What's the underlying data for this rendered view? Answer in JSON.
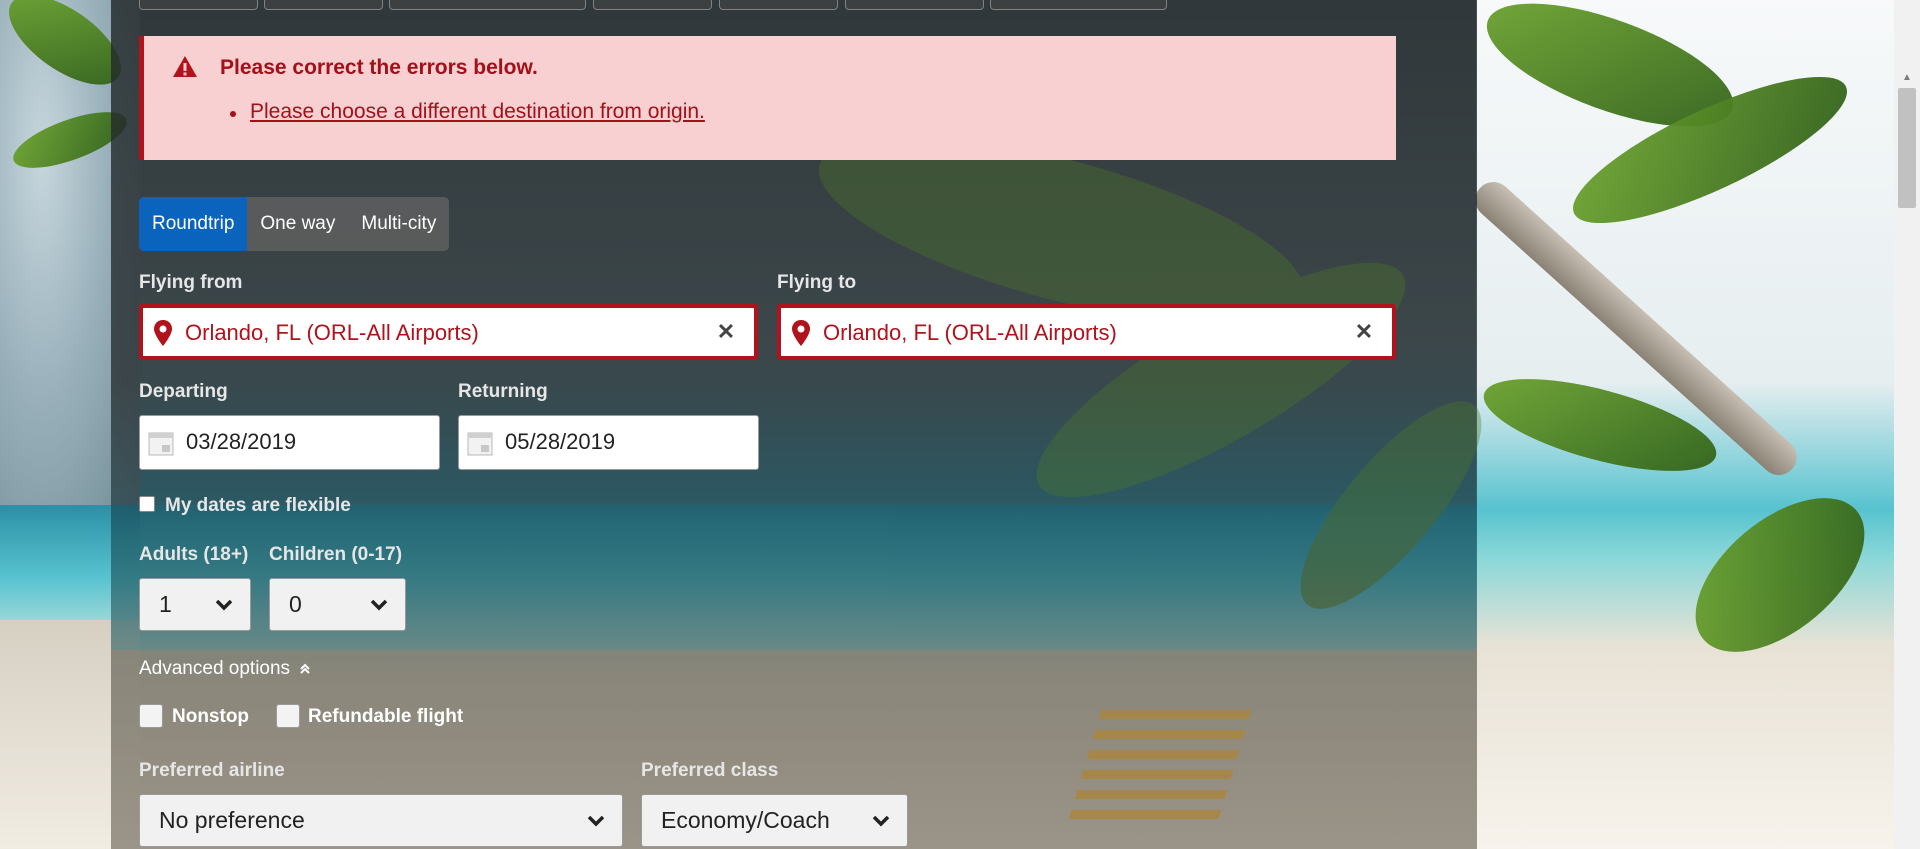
{
  "error": {
    "title": "Please correct the errors below.",
    "items": [
      "Please choose a different destination from origin."
    ]
  },
  "trip_type": {
    "options": [
      "Roundtrip",
      "One way",
      "Multi-city"
    ],
    "selected": "Roundtrip"
  },
  "flying_from": {
    "label": "Flying from",
    "value": "Orlando, FL (ORL-All Airports)",
    "clear_icon": "close-icon"
  },
  "flying_to": {
    "label": "Flying to",
    "value": "Orlando, FL (ORL-All Airports)",
    "clear_icon": "close-icon"
  },
  "departing": {
    "label": "Departing",
    "value": "03/28/2019"
  },
  "returning": {
    "label": "Returning",
    "value": "05/28/2019"
  },
  "flexible_dates": {
    "label": "My dates are flexible",
    "checked": false
  },
  "adults": {
    "label": "Adults (18+)",
    "value": "1"
  },
  "children": {
    "label": "Children (0-17)",
    "value": "0"
  },
  "advanced_options": {
    "label": "Advanced options",
    "expanded": true
  },
  "nonstop": {
    "label": "Nonstop",
    "checked": false
  },
  "refundable": {
    "label": "Refundable flight",
    "checked": false
  },
  "preferred_airline": {
    "label": "Preferred airline",
    "value": "No preference"
  },
  "preferred_class": {
    "label": "Preferred class",
    "value": "Economy/Coach"
  },
  "colors": {
    "error_red": "#b1121b",
    "error_bg": "#f8d0d1",
    "accent_blue": "#0a63bd"
  }
}
